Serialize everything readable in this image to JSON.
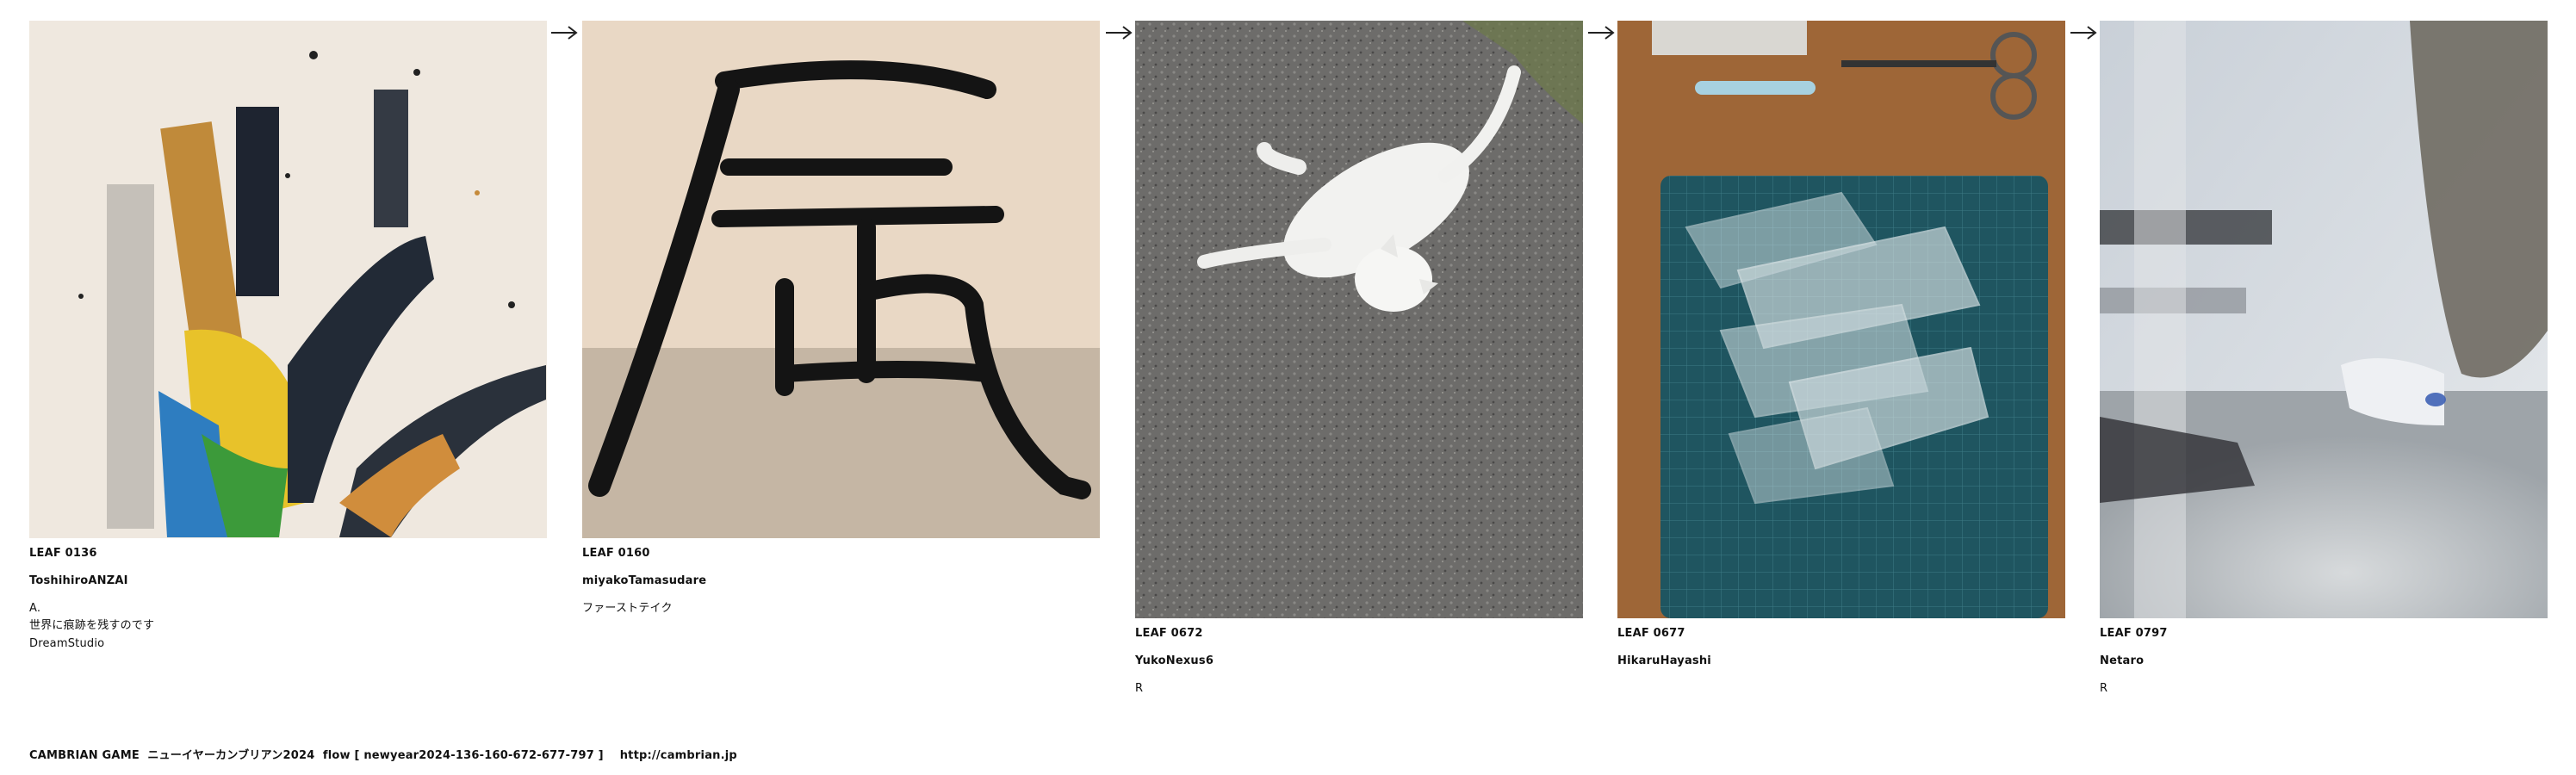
{
  "leaves": [
    {
      "id": "LEAF 0136",
      "author": "ToshihiroANZAI",
      "note": "A.\n世界に痕跡を残すのです\nDreamStudio"
    },
    {
      "id": "LEAF 0160",
      "author": "miyakoTamasudare",
      "note": "ファーストテイク"
    },
    {
      "id": "LEAF 0672",
      "author": "YukoNexus6",
      "note": "R"
    },
    {
      "id": "LEAF 0677",
      "author": "HikaruHayashi",
      "note": ""
    },
    {
      "id": "LEAF 0797",
      "author": "Netaro",
      "note": "R"
    }
  ],
  "arrow_icon": "arrow-right-icon",
  "footer": {
    "text": "CAMBRIAN GAME  ニューイヤーカンブリアン2024  flow [ newyear2024-136-160-672-677-797 ]    http://cambrian.jp"
  }
}
